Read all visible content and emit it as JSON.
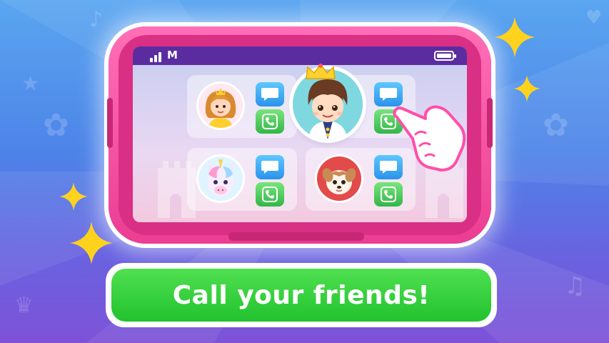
{
  "banner": {
    "text": "Call your friends!"
  },
  "phone": {
    "status_bar": {
      "carrier": "M",
      "signal_bars": 3,
      "battery_level": 1.0
    },
    "contacts": [
      {
        "name_icon": "princess-avatar",
        "actions": [
          "message-icon",
          "phone-call-icon"
        ]
      },
      {
        "name_icon": "prince-avatar",
        "actions": [
          "message-icon",
          "phone-call-icon"
        ],
        "highlighted": true
      },
      {
        "name_icon": "unicorn-avatar",
        "actions": [
          "message-icon",
          "phone-call-icon"
        ]
      },
      {
        "name_icon": "puppy-avatar",
        "actions": [
          "message-icon",
          "phone-call-icon"
        ]
      }
    ]
  },
  "colors": {
    "phone_body": "#ec3d92",
    "status_bar": "#5b2ca0",
    "message_button": "#2a93ea",
    "call_button": "#33b648",
    "banner": "#22c22e",
    "sparkle": "#ffd21e"
  }
}
